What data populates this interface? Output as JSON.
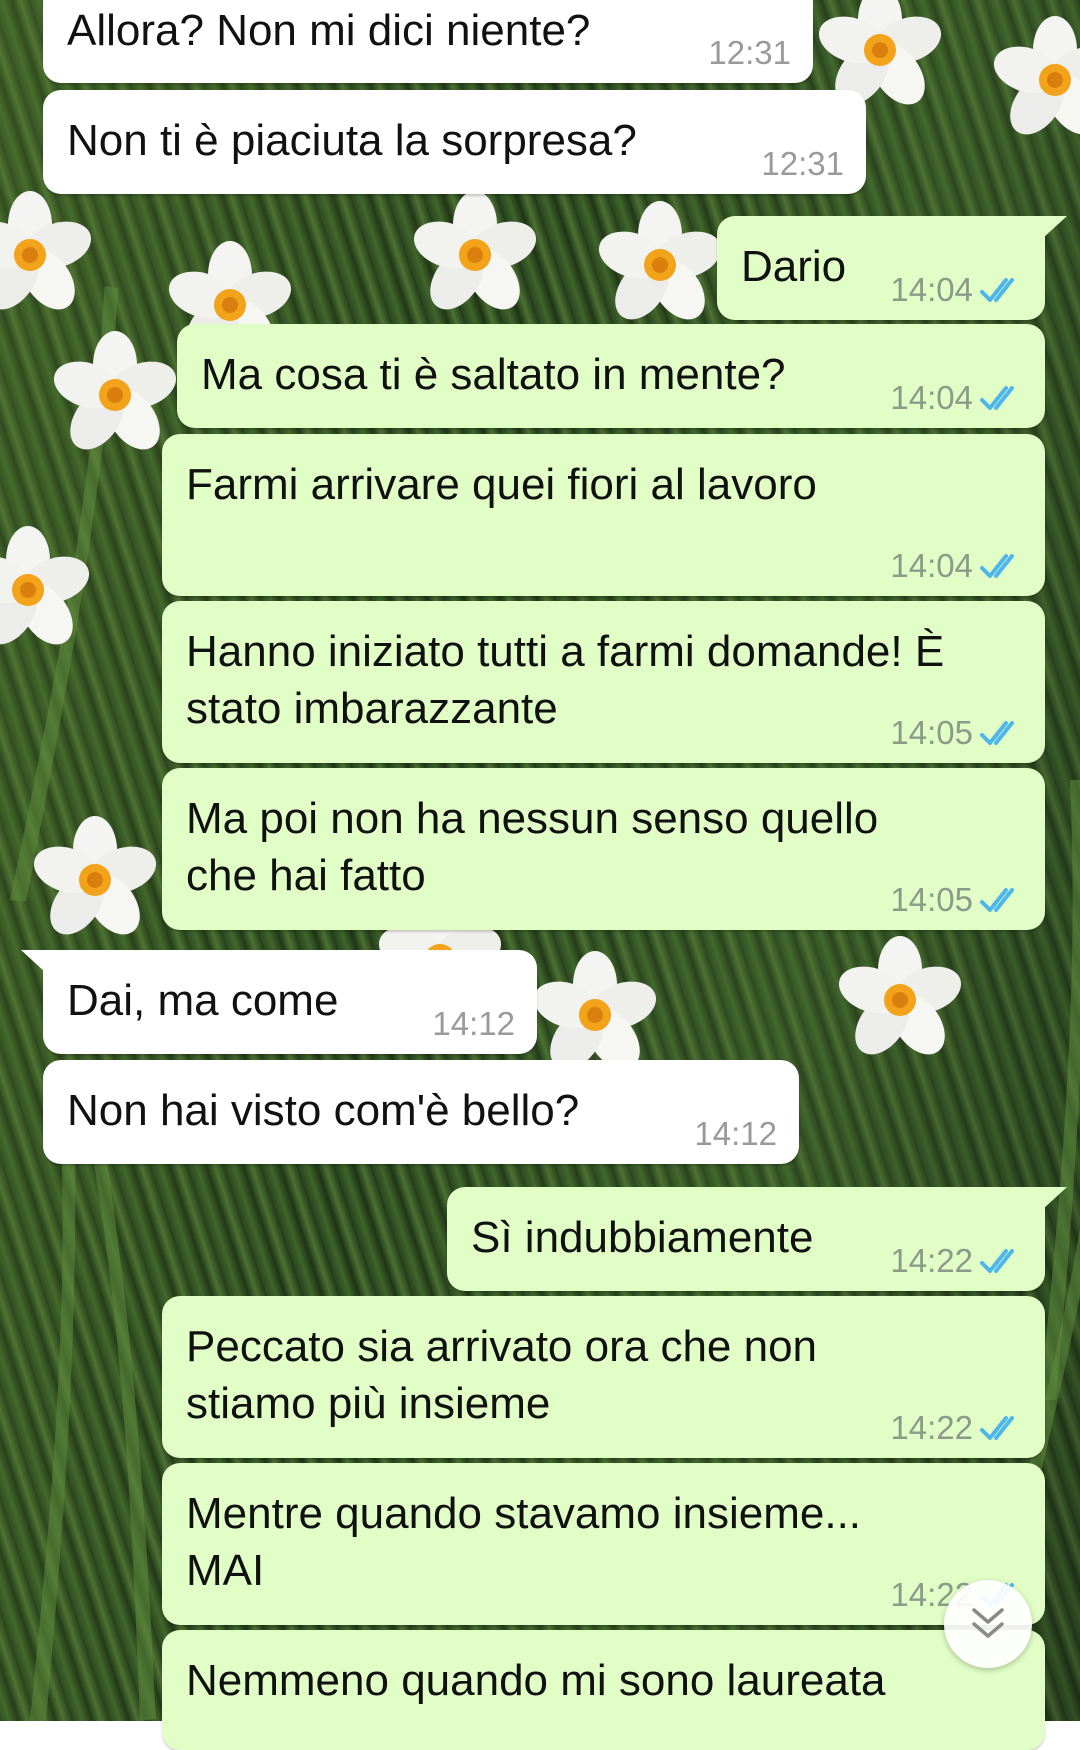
{
  "messages": [
    {
      "text": "Allora? Non mi dici niente?",
      "time": "12:31",
      "dir": "in"
    },
    {
      "text": "Non ti è piaciuta la sorpresa?",
      "time": "12:31",
      "dir": "in"
    },
    {
      "text": "Dario",
      "time": "14:04",
      "dir": "out",
      "read": true
    },
    {
      "text": "Ma cosa ti è saltato in mente?",
      "time": "14:04",
      "dir": "out",
      "read": true
    },
    {
      "text": "Farmi arrivare quei fiori al lavoro",
      "time": "14:04",
      "dir": "out",
      "read": true
    },
    {
      "line1": "Hanno iniziato tutti a farmi domande! È",
      "line2": "stato imbarazzante",
      "time": "14:05",
      "dir": "out",
      "read": true
    },
    {
      "line1": "Ma poi non ha nessun senso quello",
      "line2": "che hai fatto",
      "time": "14:05",
      "dir": "out",
      "read": true
    },
    {
      "text": "Dai, ma come",
      "time": "14:12",
      "dir": "in"
    },
    {
      "text": "Non hai visto com'è bello?",
      "time": "14:12",
      "dir": "in"
    },
    {
      "text": "Sì indubbiamente",
      "time": "14:22",
      "dir": "out",
      "read": true
    },
    {
      "line1": "Peccato sia arrivato ora che non",
      "line2": "stiamo più insieme",
      "time": "14:22",
      "dir": "out",
      "read": true
    },
    {
      "line1": "Mentre quando stavamo insieme...",
      "line2": "MAI",
      "time": "14:22",
      "dir": "out",
      "read": true
    },
    {
      "text": "Nemmeno quando mi sono laureata",
      "dir": "out"
    }
  ],
  "colors": {
    "incoming_bubble": "#ffffff",
    "outgoing_bubble": "#e1fec6",
    "read_check": "#4fb6ec",
    "timestamp": "#8c9a89"
  },
  "icons": {
    "read_receipt": "double-check-icon",
    "scroll_down": "chevron-double-down-icon"
  }
}
